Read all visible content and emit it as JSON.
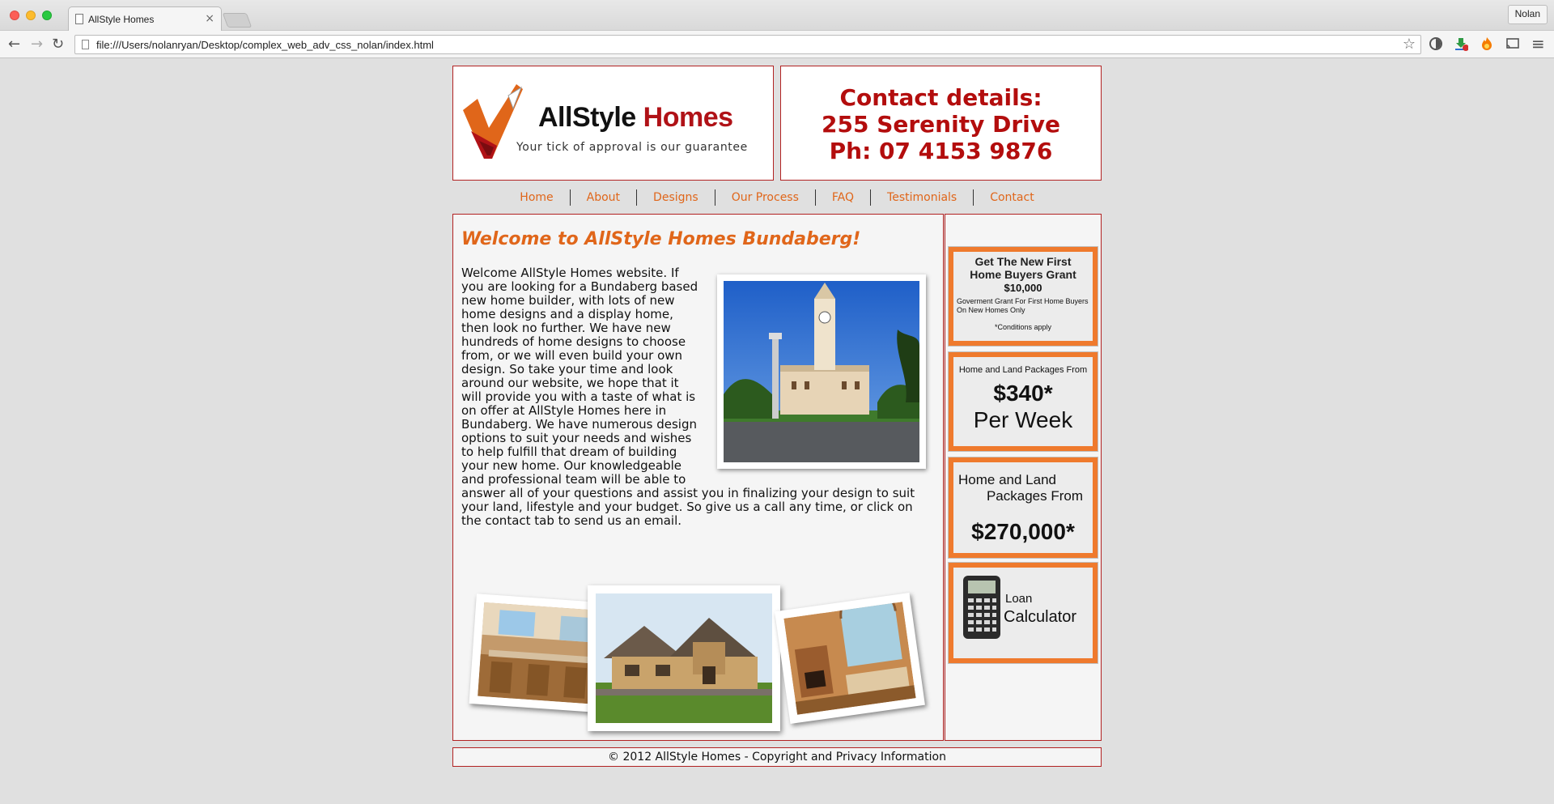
{
  "browser": {
    "tab_title": "AllStyle Homes",
    "tab_close": "×",
    "profile_name": "Nolan",
    "url": "file:///Users/nolanryan/Desktop/complex_web_adv_css_nolan/index.html",
    "back_icon": "←",
    "forward_icon": "→",
    "reload_icon": "↻",
    "star_icon": "☆",
    "menu_icon": "≡"
  },
  "header": {
    "logo_word1": "AllStyle",
    "logo_word2": "Homes",
    "logo_tagline": "Your tick of approval is our guarantee",
    "contact_heading": "Contact details:",
    "contact_address": "255 Serenity Drive",
    "contact_phone": "Ph: 07 4153 9876"
  },
  "nav": {
    "items": [
      "Home",
      "About",
      "Designs",
      "Our Process",
      "FAQ",
      "Testimonials",
      "Contact"
    ]
  },
  "main": {
    "title": "Welcome to AllStyle Homes Bundaberg!",
    "intro": "Welcome AllStyle Homes website. If you are looking for a Bundaberg based new home builder, with lots of new home designs and a display home, then look no further. We have new hundreds of home designs to choose from, or we will even build your own design. So take your time and look around our website, we hope that it will provide you with a taste of what is on offer at AllStyle Homes here in Bundaberg. We have numerous design options to suit your needs and wishes to help fulfill that dream of building your new home. Our knowledgeable and professional team will be able to answer all of your questions and assist you in finalizing your design to suit your land, lifestyle and your budget. So give us a call any time, or click on the contact tab to send us an email."
  },
  "sidebar": {
    "ad1": {
      "line1": "Get The New First",
      "line2": "Home Buyers Grant",
      "amount": "$10,000",
      "desc": "Goverment Grant For First Home Buyers On New Homes Only",
      "note": "*Conditions apply"
    },
    "ad2": {
      "heading": "Home and Land Packages From",
      "price": "$340*",
      "period": "Per Week"
    },
    "ad3": {
      "line1": "Home and Land",
      "line2": "Packages From",
      "price": "$270,000*"
    },
    "ad4": {
      "line1": "Loan",
      "line2": "Calculator"
    }
  },
  "footer": {
    "text": "© 2012 AllStyle Homes - Copyright and Privacy Information"
  }
}
